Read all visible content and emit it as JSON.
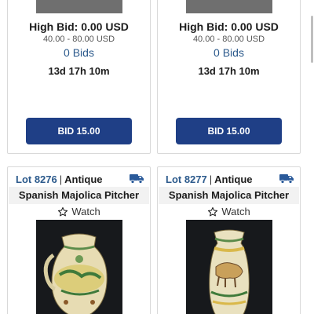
{
  "top_cards": [
    {
      "high_bid": "High Bid: 0.00 USD",
      "range": "40.00 - 80.00 USD",
      "bids": "0 Bids",
      "time_left": "13d 17h 10m",
      "bid_button": "BID 15.00"
    },
    {
      "high_bid": "High Bid: 0.00 USD",
      "range": "40.00 - 80.00 USD",
      "bids": "0 Bids",
      "time_left": "13d 17h 10m",
      "bid_button": "BID 15.00"
    }
  ],
  "bottom_cards": [
    {
      "lot": "Lot 8276",
      "separator": "|",
      "category": "Antique",
      "title": "Spanish Majolica Pitcher",
      "watch": "Watch",
      "icon": "truck-icon"
    },
    {
      "lot": "Lot 8277",
      "separator": "|",
      "category": "Antique",
      "title": "Spanish Majolica Pitcher",
      "watch": "Watch",
      "icon": "truck-icon"
    }
  ],
  "colors": {
    "accent": "#1f3f86",
    "link": "#2c5a8c",
    "truck": "#2a5a9a"
  }
}
